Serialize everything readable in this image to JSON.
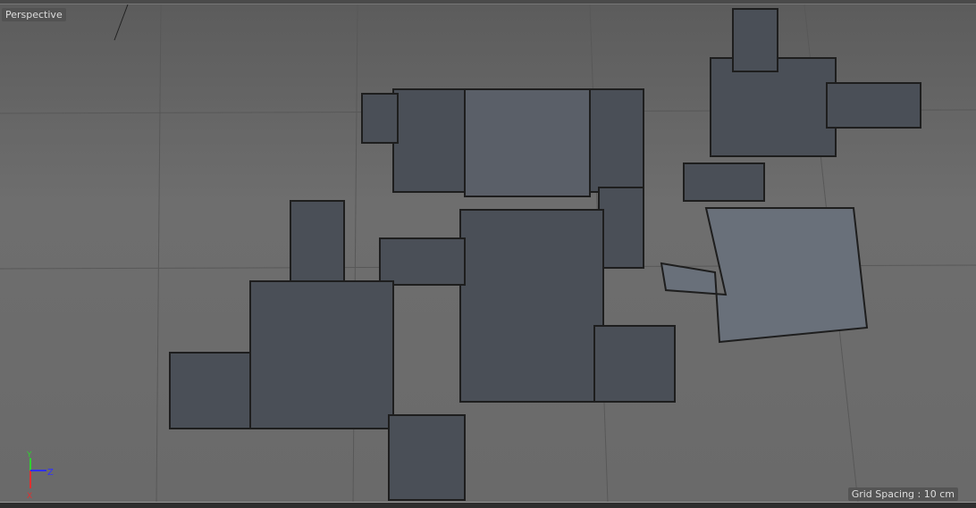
{
  "viewport": {
    "camera_label": "Perspective",
    "grid_spacing": "Grid Spacing : 10 cm"
  },
  "axes": {
    "x": "X",
    "y": "Y",
    "z": "Z",
    "x_color": "#e03030",
    "y_color": "#30d030",
    "z_color": "#3030ff"
  }
}
